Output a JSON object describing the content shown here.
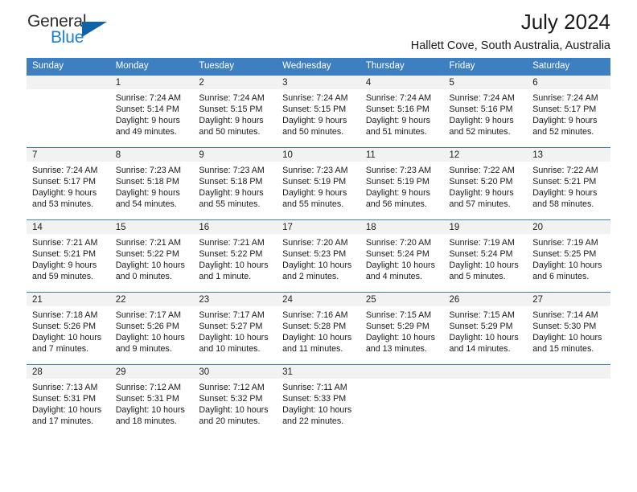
{
  "brand": {
    "name_part1": "General",
    "name_part2": "Blue",
    "triangle_icon": "triangle-icon",
    "accent_color": "#1a7fd4",
    "triangle_color": "#1163a8"
  },
  "header": {
    "month_title": "July 2024",
    "location": "Hallett Cove, South Australia, Australia"
  },
  "calendar": {
    "header_bg": "#3d7fc1",
    "daynum_bg": "#f2f2f2",
    "weekdays": [
      "Sunday",
      "Monday",
      "Tuesday",
      "Wednesday",
      "Thursday",
      "Friday",
      "Saturday"
    ],
    "weeks": [
      [
        {
          "day": "",
          "sunrise": "",
          "sunset": "",
          "daylight_line1": "",
          "daylight_line2": ""
        },
        {
          "day": "1",
          "sunrise": "Sunrise: 7:24 AM",
          "sunset": "Sunset: 5:14 PM",
          "daylight_line1": "Daylight: 9 hours",
          "daylight_line2": "and 49 minutes."
        },
        {
          "day": "2",
          "sunrise": "Sunrise: 7:24 AM",
          "sunset": "Sunset: 5:15 PM",
          "daylight_line1": "Daylight: 9 hours",
          "daylight_line2": "and 50 minutes."
        },
        {
          "day": "3",
          "sunrise": "Sunrise: 7:24 AM",
          "sunset": "Sunset: 5:15 PM",
          "daylight_line1": "Daylight: 9 hours",
          "daylight_line2": "and 50 minutes."
        },
        {
          "day": "4",
          "sunrise": "Sunrise: 7:24 AM",
          "sunset": "Sunset: 5:16 PM",
          "daylight_line1": "Daylight: 9 hours",
          "daylight_line2": "and 51 minutes."
        },
        {
          "day": "5",
          "sunrise": "Sunrise: 7:24 AM",
          "sunset": "Sunset: 5:16 PM",
          "daylight_line1": "Daylight: 9 hours",
          "daylight_line2": "and 52 minutes."
        },
        {
          "day": "6",
          "sunrise": "Sunrise: 7:24 AM",
          "sunset": "Sunset: 5:17 PM",
          "daylight_line1": "Daylight: 9 hours",
          "daylight_line2": "and 52 minutes."
        }
      ],
      [
        {
          "day": "7",
          "sunrise": "Sunrise: 7:24 AM",
          "sunset": "Sunset: 5:17 PM",
          "daylight_line1": "Daylight: 9 hours",
          "daylight_line2": "and 53 minutes."
        },
        {
          "day": "8",
          "sunrise": "Sunrise: 7:23 AM",
          "sunset": "Sunset: 5:18 PM",
          "daylight_line1": "Daylight: 9 hours",
          "daylight_line2": "and 54 minutes."
        },
        {
          "day": "9",
          "sunrise": "Sunrise: 7:23 AM",
          "sunset": "Sunset: 5:18 PM",
          "daylight_line1": "Daylight: 9 hours",
          "daylight_line2": "and 55 minutes."
        },
        {
          "day": "10",
          "sunrise": "Sunrise: 7:23 AM",
          "sunset": "Sunset: 5:19 PM",
          "daylight_line1": "Daylight: 9 hours",
          "daylight_line2": "and 55 minutes."
        },
        {
          "day": "11",
          "sunrise": "Sunrise: 7:23 AM",
          "sunset": "Sunset: 5:19 PM",
          "daylight_line1": "Daylight: 9 hours",
          "daylight_line2": "and 56 minutes."
        },
        {
          "day": "12",
          "sunrise": "Sunrise: 7:22 AM",
          "sunset": "Sunset: 5:20 PM",
          "daylight_line1": "Daylight: 9 hours",
          "daylight_line2": "and 57 minutes."
        },
        {
          "day": "13",
          "sunrise": "Sunrise: 7:22 AM",
          "sunset": "Sunset: 5:21 PM",
          "daylight_line1": "Daylight: 9 hours",
          "daylight_line2": "and 58 minutes."
        }
      ],
      [
        {
          "day": "14",
          "sunrise": "Sunrise: 7:21 AM",
          "sunset": "Sunset: 5:21 PM",
          "daylight_line1": "Daylight: 9 hours",
          "daylight_line2": "and 59 minutes."
        },
        {
          "day": "15",
          "sunrise": "Sunrise: 7:21 AM",
          "sunset": "Sunset: 5:22 PM",
          "daylight_line1": "Daylight: 10 hours",
          "daylight_line2": "and 0 minutes."
        },
        {
          "day": "16",
          "sunrise": "Sunrise: 7:21 AM",
          "sunset": "Sunset: 5:22 PM",
          "daylight_line1": "Daylight: 10 hours",
          "daylight_line2": "and 1 minute."
        },
        {
          "day": "17",
          "sunrise": "Sunrise: 7:20 AM",
          "sunset": "Sunset: 5:23 PM",
          "daylight_line1": "Daylight: 10 hours",
          "daylight_line2": "and 2 minutes."
        },
        {
          "day": "18",
          "sunrise": "Sunrise: 7:20 AM",
          "sunset": "Sunset: 5:24 PM",
          "daylight_line1": "Daylight: 10 hours",
          "daylight_line2": "and 4 minutes."
        },
        {
          "day": "19",
          "sunrise": "Sunrise: 7:19 AM",
          "sunset": "Sunset: 5:24 PM",
          "daylight_line1": "Daylight: 10 hours",
          "daylight_line2": "and 5 minutes."
        },
        {
          "day": "20",
          "sunrise": "Sunrise: 7:19 AM",
          "sunset": "Sunset: 5:25 PM",
          "daylight_line1": "Daylight: 10 hours",
          "daylight_line2": "and 6 minutes."
        }
      ],
      [
        {
          "day": "21",
          "sunrise": "Sunrise: 7:18 AM",
          "sunset": "Sunset: 5:26 PM",
          "daylight_line1": "Daylight: 10 hours",
          "daylight_line2": "and 7 minutes."
        },
        {
          "day": "22",
          "sunrise": "Sunrise: 7:17 AM",
          "sunset": "Sunset: 5:26 PM",
          "daylight_line1": "Daylight: 10 hours",
          "daylight_line2": "and 9 minutes."
        },
        {
          "day": "23",
          "sunrise": "Sunrise: 7:17 AM",
          "sunset": "Sunset: 5:27 PM",
          "daylight_line1": "Daylight: 10 hours",
          "daylight_line2": "and 10 minutes."
        },
        {
          "day": "24",
          "sunrise": "Sunrise: 7:16 AM",
          "sunset": "Sunset: 5:28 PM",
          "daylight_line1": "Daylight: 10 hours",
          "daylight_line2": "and 11 minutes."
        },
        {
          "day": "25",
          "sunrise": "Sunrise: 7:15 AM",
          "sunset": "Sunset: 5:29 PM",
          "daylight_line1": "Daylight: 10 hours",
          "daylight_line2": "and 13 minutes."
        },
        {
          "day": "26",
          "sunrise": "Sunrise: 7:15 AM",
          "sunset": "Sunset: 5:29 PM",
          "daylight_line1": "Daylight: 10 hours",
          "daylight_line2": "and 14 minutes."
        },
        {
          "day": "27",
          "sunrise": "Sunrise: 7:14 AM",
          "sunset": "Sunset: 5:30 PM",
          "daylight_line1": "Daylight: 10 hours",
          "daylight_line2": "and 15 minutes."
        }
      ],
      [
        {
          "day": "28",
          "sunrise": "Sunrise: 7:13 AM",
          "sunset": "Sunset: 5:31 PM",
          "daylight_line1": "Daylight: 10 hours",
          "daylight_line2": "and 17 minutes."
        },
        {
          "day": "29",
          "sunrise": "Sunrise: 7:12 AM",
          "sunset": "Sunset: 5:31 PM",
          "daylight_line1": "Daylight: 10 hours",
          "daylight_line2": "and 18 minutes."
        },
        {
          "day": "30",
          "sunrise": "Sunrise: 7:12 AM",
          "sunset": "Sunset: 5:32 PM",
          "daylight_line1": "Daylight: 10 hours",
          "daylight_line2": "and 20 minutes."
        },
        {
          "day": "31",
          "sunrise": "Sunrise: 7:11 AM",
          "sunset": "Sunset: 5:33 PM",
          "daylight_line1": "Daylight: 10 hours",
          "daylight_line2": "and 22 minutes."
        },
        {
          "day": "",
          "sunrise": "",
          "sunset": "",
          "daylight_line1": "",
          "daylight_line2": ""
        },
        {
          "day": "",
          "sunrise": "",
          "sunset": "",
          "daylight_line1": "",
          "daylight_line2": ""
        },
        {
          "day": "",
          "sunrise": "",
          "sunset": "",
          "daylight_line1": "",
          "daylight_line2": ""
        }
      ]
    ]
  }
}
